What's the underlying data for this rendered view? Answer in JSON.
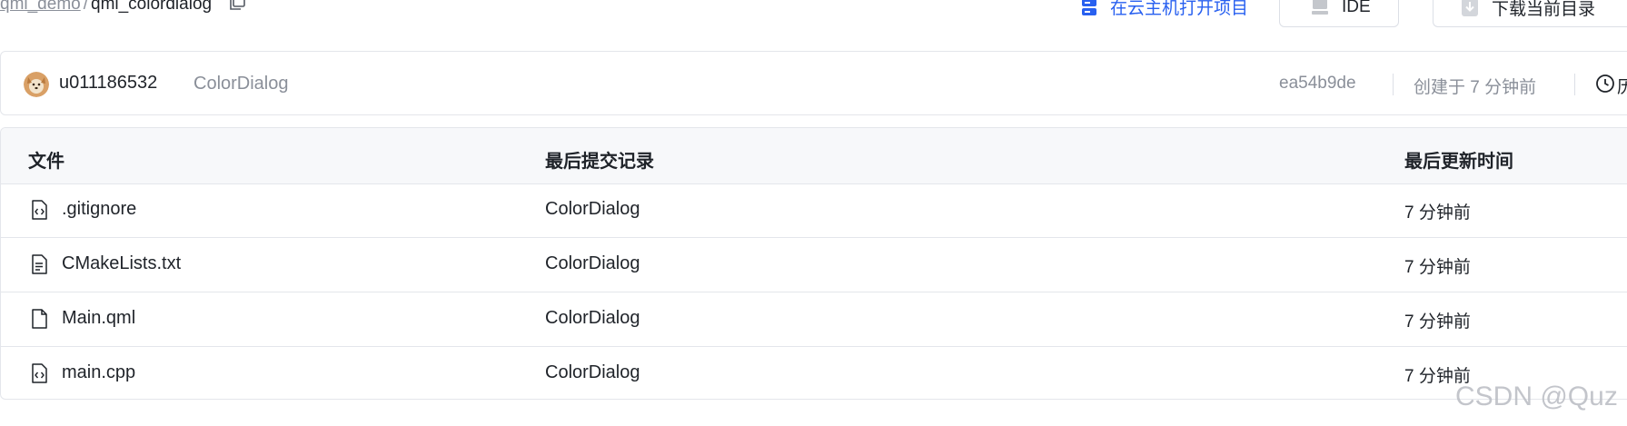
{
  "breadcrumb": {
    "repo": "qml_demo",
    "separator": "/",
    "current": "qml_colordialog"
  },
  "actions": {
    "cloud_open": "在云主机打开项目",
    "ide": "IDE",
    "download": "下载当前目录"
  },
  "commit": {
    "author": "u011186532",
    "message": "ColorDialog",
    "hash": "ea54b9de",
    "created": "创建于 7 分钟前",
    "history_partial": "历"
  },
  "table": {
    "headers": {
      "file": "文件",
      "last_commit": "最后提交记录",
      "last_updated": "最后更新时间"
    },
    "rows": [
      {
        "name": ".gitignore",
        "icon": "code-file-icon",
        "commit": "ColorDialog",
        "time": "7 分钟前"
      },
      {
        "name": "CMakeLists.txt",
        "icon": "text-file-icon",
        "commit": "ColorDialog",
        "time": "7 分钟前"
      },
      {
        "name": "Main.qml",
        "icon": "file-icon",
        "commit": "ColorDialog",
        "time": "7 分钟前"
      },
      {
        "name": "main.cpp",
        "icon": "code-file-icon",
        "commit": "ColorDialog",
        "time": "7 分钟前"
      }
    ]
  },
  "watermark": "CSDN @Quz",
  "colors": {
    "link": "#2860f0",
    "muted": "#8a8f99",
    "border": "#e4e6eb",
    "header_bg": "#f7f8fa"
  }
}
